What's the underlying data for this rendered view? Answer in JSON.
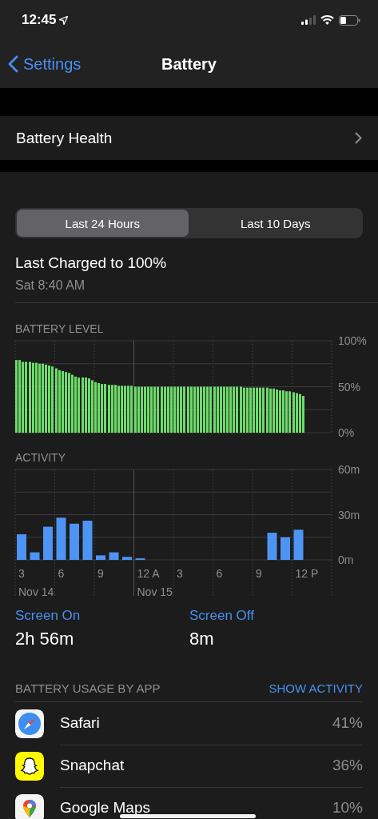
{
  "status_bar": {
    "time": "12:45"
  },
  "nav": {
    "back": "Settings",
    "title": "Battery"
  },
  "health_row": {
    "label": "Battery Health"
  },
  "segments": [
    {
      "label": "Last 24 Hours",
      "selected": true
    },
    {
      "label": "Last 10 Days",
      "selected": false
    }
  ],
  "last_charged": {
    "title": "Last Charged to 100%",
    "time": "Sat 8:40 AM"
  },
  "battery_level": {
    "chart_data": {
      "type": "bar",
      "title": "BATTERY LEVEL",
      "ylim": [
        0,
        100
      ],
      "yticks": [
        {
          "value": 0,
          "label": "0%"
        },
        {
          "value": 50,
          "label": "50%"
        },
        {
          "value": 100,
          "label": "100%"
        }
      ],
      "values": [
        79,
        79,
        77,
        77,
        77,
        76,
        76,
        75,
        75,
        74,
        73,
        72,
        70,
        68,
        67,
        66,
        65,
        63,
        61,
        60,
        60,
        60,
        59,
        57,
        55,
        54,
        53,
        53,
        52,
        52,
        52,
        51,
        51,
        51,
        51,
        51,
        50,
        50,
        50,
        50,
        50,
        50,
        50,
        50,
        50,
        50,
        50,
        50,
        50,
        50,
        50,
        50,
        50,
        50,
        50,
        50,
        50,
        50,
        50,
        50,
        50,
        50,
        50,
        50,
        50,
        50,
        50,
        50,
        50,
        49,
        49,
        49,
        49,
        49,
        49,
        49,
        49,
        48,
        48,
        47,
        46,
        46,
        45,
        45,
        44,
        43,
        42,
        40,
        null,
        null,
        null,
        null,
        null,
        null,
        null,
        null
      ]
    }
  },
  "activity": {
    "chart_data": {
      "type": "bar",
      "title": "ACTIVITY",
      "ylim": [
        0,
        60
      ],
      "yticks": [
        {
          "value": 0,
          "label": "0m"
        },
        {
          "value": 30,
          "label": "30m"
        },
        {
          "value": 60,
          "label": "60m"
        }
      ],
      "values": [
        17,
        5,
        22,
        28,
        24,
        26,
        3,
        5,
        2,
        1,
        0,
        0,
        0,
        0,
        0,
        0,
        0,
        0,
        0,
        18,
        15,
        20,
        null,
        null
      ]
    },
    "x_labels": [
      "3",
      "6",
      "9",
      "12 A",
      "3",
      "6",
      "9",
      "12 P"
    ],
    "date_labels": [
      "Nov 14",
      "Nov 15"
    ]
  },
  "screen_stats": [
    {
      "label": "Screen On",
      "value": "2h 56m"
    },
    {
      "label": "Screen Off",
      "value": "8m"
    }
  ],
  "usage": {
    "title": "BATTERY USAGE BY APP",
    "action": "SHOW ACTIVITY",
    "apps": [
      {
        "kind": "safari",
        "name": "Safari",
        "percent": "41%"
      },
      {
        "kind": "snapchat",
        "name": "Snapchat",
        "percent": "36%"
      },
      {
        "kind": "maps",
        "name": "Google Maps",
        "percent": "10%"
      }
    ]
  }
}
